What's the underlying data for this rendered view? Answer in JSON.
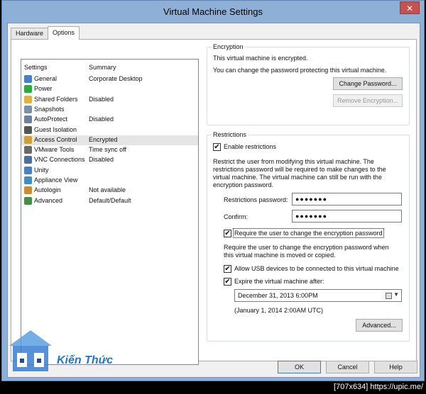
{
  "window": {
    "title": "Virtual Machine Settings",
    "close_glyph": "✕"
  },
  "tabs": [
    {
      "label": "Hardware"
    },
    {
      "label": "Options"
    }
  ],
  "settings_list": {
    "col_settings": "Settings",
    "col_summary": "Summary",
    "items": [
      {
        "name": "General",
        "summary": "Corporate Desktop",
        "icon": "general-icon",
        "color": "#4a7fc1"
      },
      {
        "name": "Power",
        "summary": "",
        "icon": "power-icon",
        "color": "#2eaa3c"
      },
      {
        "name": "Shared Folders",
        "summary": "Disabled",
        "icon": "shared-folders-icon",
        "color": "#e0b43a"
      },
      {
        "name": "Snapshots",
        "summary": "",
        "icon": "snapshots-icon",
        "color": "#7a8fa8"
      },
      {
        "name": "AutoProtect",
        "summary": "Disabled",
        "icon": "autoprotect-icon",
        "color": "#6f7fa0"
      },
      {
        "name": "Guest Isolation",
        "summary": "",
        "icon": "guest-isolation-icon",
        "color": "#555555"
      },
      {
        "name": "Access Control",
        "summary": "Encrypted",
        "icon": "access-control-icon",
        "color": "#c9a23a"
      },
      {
        "name": "VMware Tools",
        "summary": "Time sync off",
        "icon": "vmware-tools-icon",
        "color": "#6a6a6a"
      },
      {
        "name": "VNC Connections",
        "summary": "Disabled",
        "icon": "vnc-connections-icon",
        "color": "#4f6e9a"
      },
      {
        "name": "Unity",
        "summary": "",
        "icon": "unity-icon",
        "color": "#4a7fc1"
      },
      {
        "name": "Appliance View",
        "summary": "",
        "icon": "appliance-view-icon",
        "color": "#3f8fbf"
      },
      {
        "name": "Autologin",
        "summary": "Not available",
        "icon": "autologin-icon",
        "color": "#d08a2a"
      },
      {
        "name": "Advanced",
        "summary": "Default/Default",
        "icon": "advanced-icon",
        "color": "#4a8a4a"
      }
    ],
    "selected_index": 6
  },
  "encryption": {
    "legend": "Encryption",
    "line1": "This virtual machine is encrypted.",
    "line2": "You can change the password protecting this virtual machine.",
    "change_password_button": "Change Password...",
    "remove_encryption_button": "Remove Encryption..."
  },
  "restrictions": {
    "legend": "Restrictions",
    "enable_label": "Enable restrictions",
    "description_lines": [
      "Restrict the user from modifying this virtual machine. The",
      "restrictions password will be required to make changes to the",
      "virtual machine. The virtual machine can still be run with the",
      "encryption password."
    ],
    "restrictions_password_label": "Restrictions password:",
    "restrictions_password_value": "●●●●●●●",
    "confirm_label": "Confirm:",
    "confirm_value": "●●●●●●●",
    "require_change_label": "Require the user to change the encryption password",
    "require_change_desc_lines": [
      "Require the user to change the encryption password when",
      "this virtual machine is moved or copied."
    ],
    "allow_usb_label": "Allow USB devices to be connected to this virtual machine",
    "expire_label": "Expire the virtual machine after:",
    "expire_datetime": "December 31, 2013   6:00PM",
    "expire_utc": "(January 1, 2014 2:00AM UTC)",
    "advanced_button": "Advanced..."
  },
  "footer": {
    "ok": "OK",
    "cancel": "Cancel",
    "help": "Help"
  },
  "statusbar": {
    "text": "[707x634] https://upic.me/"
  },
  "watermark": {
    "text": "Kiến Thức"
  },
  "check_glyph": "✔"
}
